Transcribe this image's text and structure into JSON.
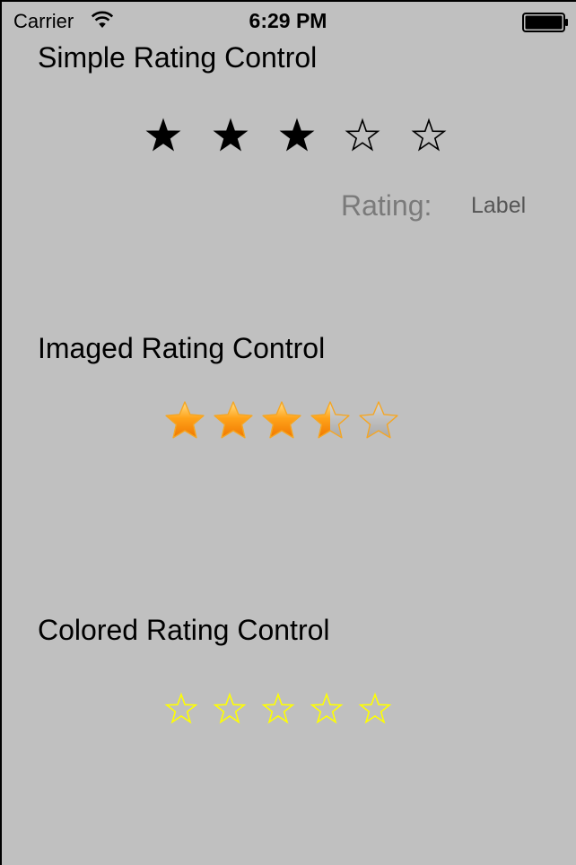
{
  "status_bar": {
    "carrier": "Carrier",
    "time": "6:29 PM",
    "wifi_icon": "wifi-icon",
    "battery_icon": "battery-icon"
  },
  "simple_rating": {
    "title": "Simple Rating Control",
    "rating": 3,
    "max": 5,
    "rating_caption": "Rating:",
    "rating_value_label": "Label",
    "star_color": "#000000"
  },
  "imaged_rating": {
    "title": "Imaged Rating Control",
    "rating": 3.5,
    "max": 5,
    "filled_color": "#ffa31a",
    "empty_color": "#a8a8a8"
  },
  "colored_rating": {
    "title": "Colored Rating Control",
    "rating": 0,
    "max": 5,
    "star_color": "#ffff00"
  }
}
